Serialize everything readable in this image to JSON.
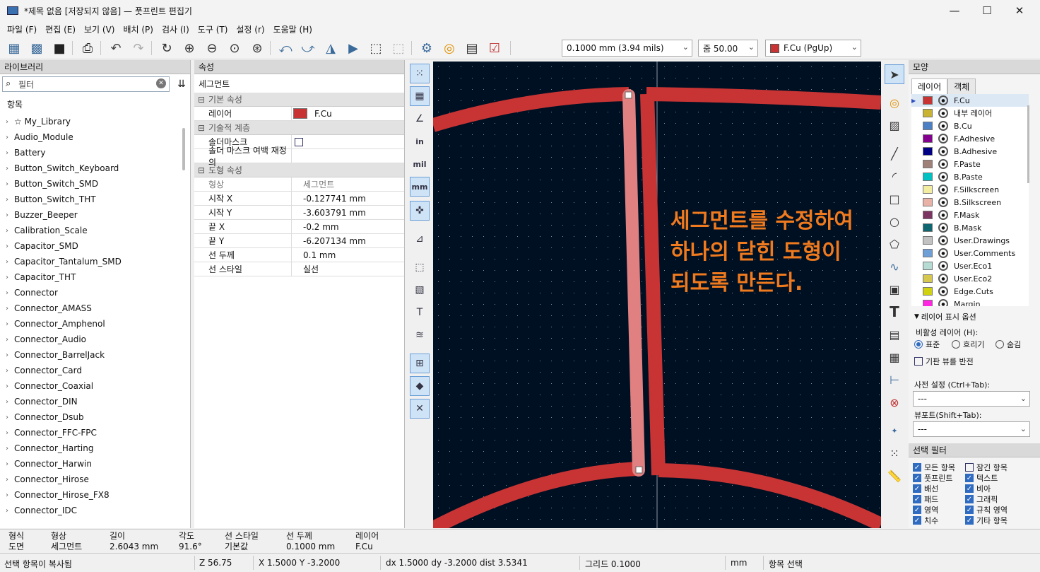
{
  "window": {
    "title": "*제목 없음 [저장되지 않음] — 풋프린트 편집기",
    "min": "—",
    "max": "☐",
    "close": "✕"
  },
  "menu": [
    "파일 (F)",
    "편집 (E)",
    "보기 (V)",
    "배치 (P)",
    "검사 (I)",
    "도구 (T)",
    "설정 (r)",
    "도움말 (H)"
  ],
  "toolbar": {
    "grid_value": "0.1000 mm (3.94 mils)",
    "zoom_value": "줌 50.00",
    "layer_value": "F.Cu (PgUp)",
    "layer_color": "#c83434"
  },
  "library": {
    "header": "라이브러리",
    "filter_placeholder": "필터",
    "column_header": "항목",
    "items": [
      "☆ My_Library",
      "Audio_Module",
      "Battery",
      "Button_Switch_Keyboard",
      "Button_Switch_SMD",
      "Button_Switch_THT",
      "Buzzer_Beeper",
      "Calibration_Scale",
      "Capacitor_SMD",
      "Capacitor_Tantalum_SMD",
      "Capacitor_THT",
      "Connector",
      "Connector_AMASS",
      "Connector_Amphenol",
      "Connector_Audio",
      "Connector_BarrelJack",
      "Connector_Card",
      "Connector_Coaxial",
      "Connector_DIN",
      "Connector_Dsub",
      "Connector_FFC-FPC",
      "Connector_Harting",
      "Connector_Harwin",
      "Connector_Hirose",
      "Connector_Hirose_FX8",
      "Connector_IDC"
    ]
  },
  "properties": {
    "header": "속성",
    "subheader": "세그먼트",
    "groups": [
      {
        "name": "기본 속성",
        "rows": [
          {
            "k": "레이어",
            "v": "F.Cu",
            "swatch": "#c83434"
          }
        ]
      },
      {
        "name": "기술적 계층",
        "rows": [
          {
            "k": "솔더마스크",
            "v": "",
            "checkbox": true
          },
          {
            "k": "솔더 마스크 여백 재정의",
            "v": ""
          }
        ]
      },
      {
        "name": "도형 속성",
        "rows": [
          {
            "k": "형상",
            "v": "세그먼트",
            "dim": true
          },
          {
            "k": "시작 X",
            "v": "-0.127741 mm"
          },
          {
            "k": "시작 Y",
            "v": "-3.603791 mm"
          },
          {
            "k": "끝 X",
            "v": "-0.2 mm"
          },
          {
            "k": "끝 Y",
            "v": "-6.207134 mm"
          },
          {
            "k": "선 두께",
            "v": "0.1 mm"
          },
          {
            "k": "선 스타일",
            "v": "실선"
          }
        ]
      }
    ]
  },
  "canvas": {
    "annotation": [
      "세그먼트를 수정하여",
      "하나의 닫힌 도형이",
      "되도록 만든다."
    ],
    "annotation_color": "#f07a1e",
    "trace_color": "#c83434",
    "selected_color": "#e08080",
    "bg_color": "#001023"
  },
  "right_panel": {
    "header": "모양",
    "tabs": [
      "레이어",
      "객체"
    ],
    "layers": [
      {
        "name": "F.Cu",
        "color": "#c83434"
      },
      {
        "name": "내부 레이어",
        "color": "#c8b432"
      },
      {
        "name": "B.Cu",
        "color": "#4d7fc4"
      },
      {
        "name": "F.Adhesive",
        "color": "#84008f"
      },
      {
        "name": "B.Adhesive",
        "color": "#000084"
      },
      {
        "name": "F.Paste",
        "color": "#a0817a"
      },
      {
        "name": "B.Paste",
        "color": "#00c2c2"
      },
      {
        "name": "F.Silkscreen",
        "color": "#f2eda1"
      },
      {
        "name": "B.Silkscreen",
        "color": "#e8b2a7"
      },
      {
        "name": "F.Mask",
        "color": "#7c3462"
      },
      {
        "name": "B.Mask",
        "color": "#0f6670"
      },
      {
        "name": "User.Drawings",
        "color": "#c2c2c2"
      },
      {
        "name": "User.Comments",
        "color": "#6e9fd6"
      },
      {
        "name": "User.Eco1",
        "color": "#b5dbd2"
      },
      {
        "name": "User.Eco2",
        "color": "#d6c84f"
      },
      {
        "name": "Edge.Cuts",
        "color": "#d0d210"
      },
      {
        "name": "Margin",
        "color": "#ff26e2"
      }
    ],
    "display_options": "레이어 표시 옵션",
    "inactive_label": "비활성 레이어 (H):",
    "radio": [
      "표준",
      "흐리기",
      "숨김"
    ],
    "flip_label": "기판 뷰를 반전",
    "preset_label": "사전 설정 (Ctrl+Tab):",
    "preset_value": "---",
    "viewport_label": "뷰포트(Shift+Tab):",
    "viewport_value": "---",
    "selection_filter": "선택 필터",
    "filters": [
      {
        "label": "모든 항목",
        "on": true
      },
      {
        "label": "잠긴 항목",
        "on": false
      },
      {
        "label": "풋프린트",
        "on": true
      },
      {
        "label": "텍스트",
        "on": true
      },
      {
        "label": "배선",
        "on": true
      },
      {
        "label": "비아",
        "on": true
      },
      {
        "label": "패드",
        "on": true
      },
      {
        "label": "그래픽",
        "on": true
      },
      {
        "label": "영역",
        "on": true
      },
      {
        "label": "규칙 영역",
        "on": true
      },
      {
        "label": "치수",
        "on": true
      },
      {
        "label": "기타 항목",
        "on": true
      }
    ]
  },
  "msgbar": {
    "cols": [
      {
        "h": "형식",
        "v": "도면"
      },
      {
        "h": "형상",
        "v": "세그먼트"
      },
      {
        "h": "길이",
        "v": "2.6043 mm"
      },
      {
        "h": "각도",
        "v": "91.6°"
      },
      {
        "h": "선 스타일",
        "v": "기본값"
      },
      {
        "h": "선 두께",
        "v": "0.1000 mm"
      },
      {
        "h": "레이어",
        "v": "F.Cu"
      }
    ]
  },
  "status": {
    "msg": "선택 항목이 복사됨",
    "z": "Z 56.75",
    "xy": "X 1.5000  Y -3.2000",
    "delta": "dx 1.5000  dy -3.2000  dist 3.5341",
    "grid": "그리드 0.1000",
    "units": "mm",
    "mode": "항목 선택"
  }
}
